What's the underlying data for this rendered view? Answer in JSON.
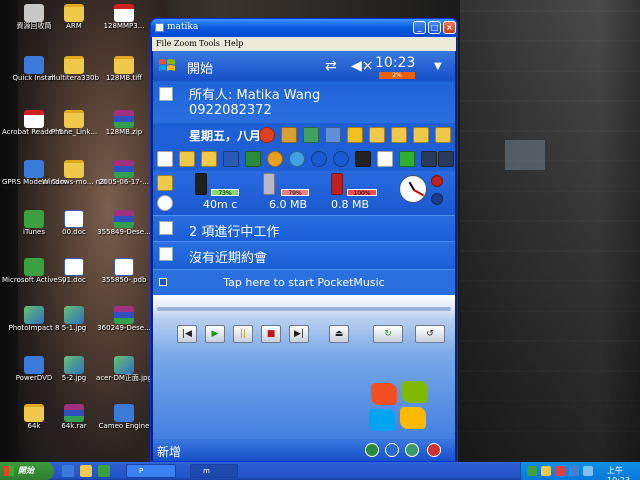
{
  "desktop": {
    "icons": [
      {
        "label": "資源回收筒",
        "kind": "trash"
      },
      {
        "label": "ARM",
        "kind": "folder"
      },
      {
        "label": "128MMP3...",
        "kind": "pdf"
      },
      {
        "label": "Quick Install",
        "kind": "app"
      },
      {
        "label": "multitera330b",
        "kind": "folder"
      },
      {
        "label": "128MB.tiff",
        "kind": "folder"
      },
      {
        "label": "Acrobat Reader 5.0",
        "kind": "pdf"
      },
      {
        "label": "Phone_Link...",
        "kind": "folder"
      },
      {
        "label": "128MB.zip",
        "kind": "rar"
      },
      {
        "label": "GPRS Modem Connection",
        "kind": "app"
      },
      {
        "label": "Windows-mo... n30-4g2",
        "kind": "folder"
      },
      {
        "label": "2005-06-17-...",
        "kind": "rar"
      },
      {
        "label": "iTunes",
        "kind": "green"
      },
      {
        "label": "00.doc",
        "kind": "doc"
      },
      {
        "label": "355849-Dese...",
        "kind": "rar"
      },
      {
        "label": "Microsoft ActiveSync",
        "kind": "green"
      },
      {
        "label": "01.doc",
        "kind": "doc"
      },
      {
        "label": "355850-.pdb",
        "kind": "doc"
      },
      {
        "label": "PhotoImpact 8",
        "kind": "img"
      },
      {
        "label": "5-1.jpg",
        "kind": "img"
      },
      {
        "label": "360249-Dese...",
        "kind": "rar"
      },
      {
        "label": "PowerDVD",
        "kind": "app"
      },
      {
        "label": "5-2.jpg",
        "kind": "img"
      },
      {
        "label": "acer-DM正面.jpg",
        "kind": "img"
      },
      {
        "label": "64k",
        "kind": "folder"
      },
      {
        "label": "64k.rar",
        "kind": "rar"
      },
      {
        "label": "Cameo Engine",
        "kind": "app"
      }
    ]
  },
  "window": {
    "title": "matika",
    "buttons": {
      "minimize": "_",
      "maximize": "□",
      "close": "×"
    },
    "menu": [
      "File",
      "Zoom",
      "Tools",
      "Help"
    ]
  },
  "device": {
    "start_label": "開始",
    "clock": "10:23",
    "battery_badge": "2%",
    "owner_name": "所有人: Matika Wang",
    "owner_phone": "0922082372",
    "date": "星期五，八月 6",
    "status": {
      "battery_pct": "73%",
      "battery_time": "40m c",
      "memory_pct": "79%",
      "memory_value": "6.0 MB",
      "storage_pct": "100%",
      "storage_value": "0.8 MB"
    },
    "tasks": "2 項進行中工作",
    "appointments": "沒有近期約會",
    "music_hint": "Tap here to start PocketMusic",
    "player_controls": [
      "|◀",
      "▶",
      "||",
      "■",
      "▶|",
      "⏏",
      "↻",
      "↺"
    ],
    "new_label": "新增"
  },
  "taskbar": {
    "start": "開始",
    "tasks": [
      "P",
      "m"
    ],
    "clock": "上午 10:23"
  },
  "colors": {
    "pp_blue": "#1e5fd6",
    "xp_taskbar": "#2456c8",
    "start_green": "#3c9a3c"
  }
}
